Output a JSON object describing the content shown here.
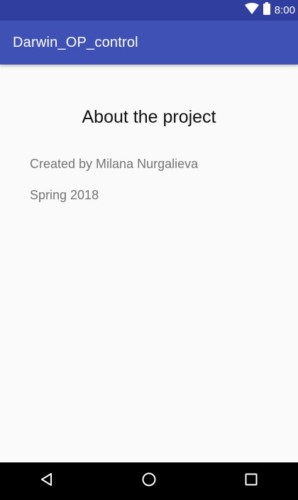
{
  "status_bar": {
    "time": "8:00",
    "icons": [
      "wifi-icon",
      "battery-icon"
    ]
  },
  "app_bar": {
    "title": "Darwin_OP_control"
  },
  "about": {
    "heading": "About the project",
    "author_line": "Created by Milana Nurgalieva",
    "date_line": "Spring 2018"
  },
  "nav_bar": {
    "buttons": [
      "back-icon",
      "home-icon",
      "recents-icon"
    ]
  },
  "colors": {
    "status_bar": "#303f9f",
    "app_bar": "#3f51b5",
    "background": "#fafafa",
    "secondary_text": "#757575",
    "nav_bar": "#000000"
  }
}
